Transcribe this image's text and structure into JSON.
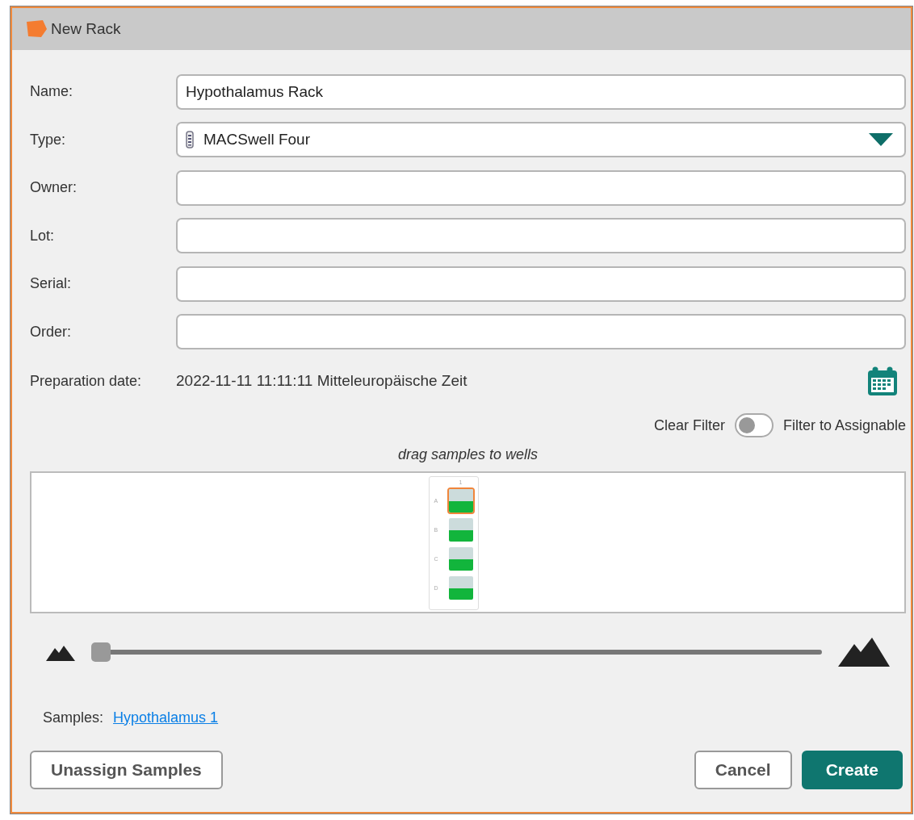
{
  "window": {
    "title": "New Rack"
  },
  "fields": [
    {
      "label": "Name:",
      "value": "Hypothalamus Rack",
      "kind": "text"
    },
    {
      "label": "Type:",
      "value": "MACSwell Four",
      "kind": "select"
    },
    {
      "label": "Owner:",
      "kind": "text"
    },
    {
      "label": "Lot:",
      "kind": "text"
    },
    {
      "label": "Serial:",
      "kind": "text"
    },
    {
      "label": "Order:",
      "kind": "text"
    }
  ],
  "preparation_date": {
    "label": "Preparation date:",
    "value": "2022-11-11 11:11:11 Mitteleuropäische Zeit"
  },
  "filter": {
    "left_label": "Clear Filter",
    "right_label": "Filter to Assignable",
    "on": false
  },
  "plate": {
    "hint": "drag samples to wells",
    "column": "1",
    "wells": [
      {
        "row": "A",
        "selected": true
      },
      {
        "row": "B",
        "selected": false
      },
      {
        "row": "C",
        "selected": false
      },
      {
        "row": "D",
        "selected": false
      }
    ]
  },
  "zoom_slider": {
    "level": 0
  },
  "samples": {
    "label": "Samples:",
    "link": "Hypothalamus 1"
  },
  "buttons": [
    {
      "label": "Unassign Samples",
      "kind": "secondary"
    },
    {
      "label": "Cancel",
      "kind": "secondary"
    },
    {
      "label": "Create",
      "kind": "primary"
    }
  ]
}
